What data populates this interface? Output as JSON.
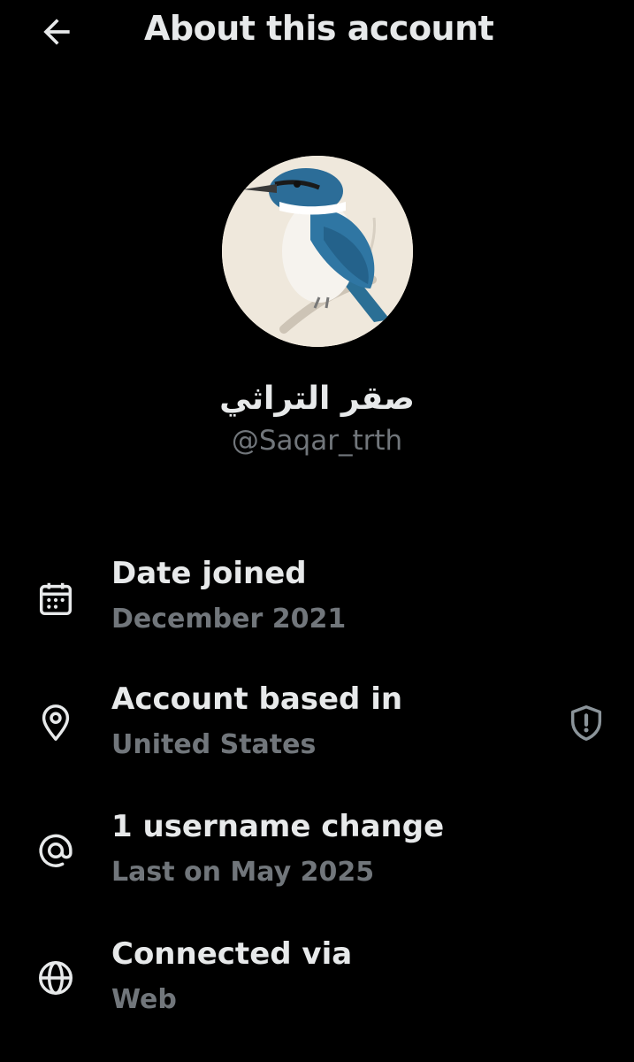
{
  "header": {
    "back_icon": "arrow-left-icon",
    "title": "About this account"
  },
  "profile": {
    "avatar_description_icon": "kingfisher-avatar",
    "display_name": "صقر التراثي",
    "handle": "@Saqar_trth"
  },
  "details": [
    {
      "icon": "calendar-icon",
      "title": "Date joined",
      "value": "December 2021"
    },
    {
      "icon": "location-pin-icon",
      "title": "Account based in",
      "value": "United States",
      "extra_icon": "shield-alert-icon"
    },
    {
      "icon": "at-sign-icon",
      "title": "1 username change",
      "value": "Last on May 2025"
    },
    {
      "icon": "globe-icon",
      "title": "Connected via",
      "value": "Web"
    }
  ],
  "colors": {
    "background": "#000000",
    "primary_text": "#e7e9ea",
    "secondary_text": "#71767b"
  }
}
